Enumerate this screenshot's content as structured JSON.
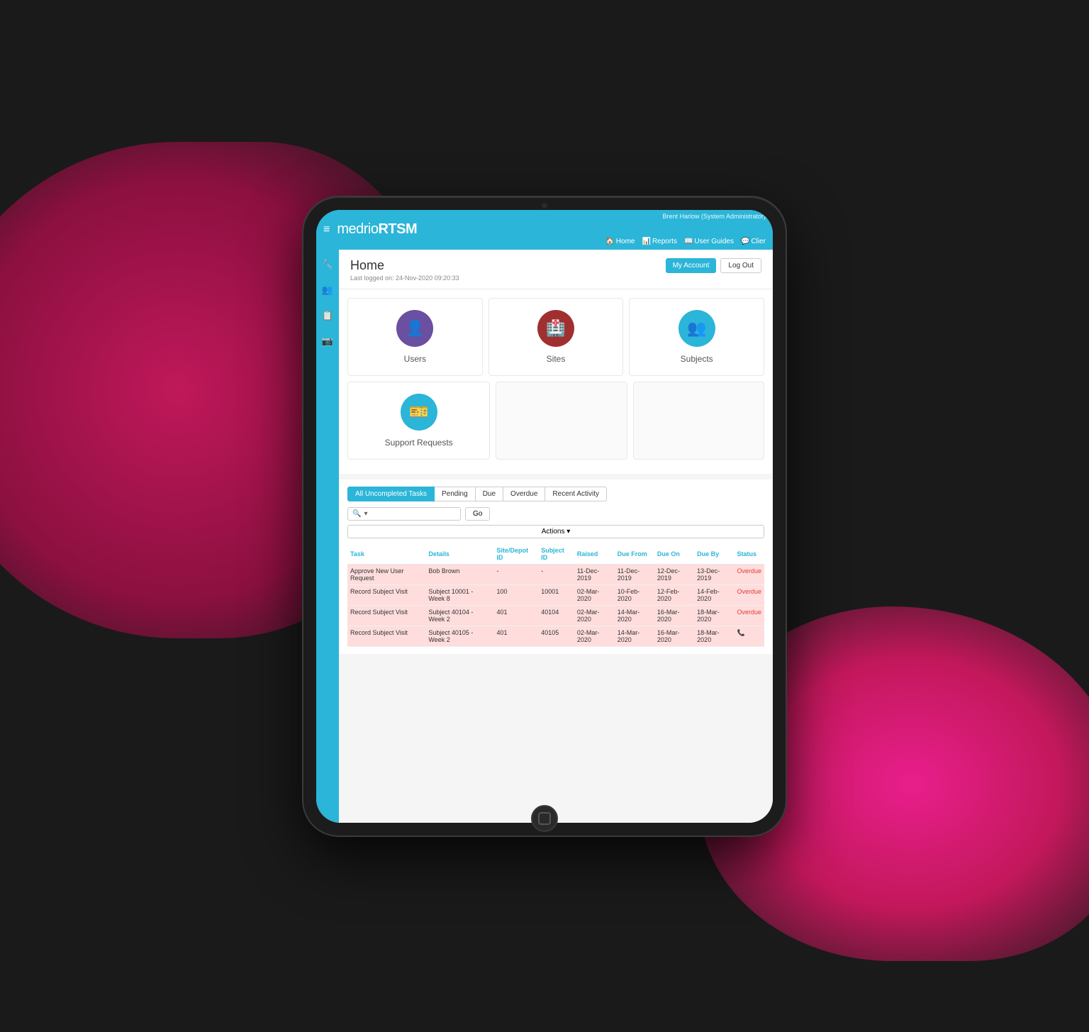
{
  "background": {
    "blob1_color": "#c0185a",
    "blob2_color": "#e91e8c"
  },
  "header": {
    "logo_text": "medrio",
    "logo_suffix": "RTSM",
    "user_info": "Brent Harlow (System Administrator)",
    "hamburger": "≡",
    "nav_items": [
      {
        "icon": "🏠",
        "label": "Home"
      },
      {
        "icon": "📊",
        "label": "Reports"
      },
      {
        "icon": "📖",
        "label": "User Guides"
      },
      {
        "icon": "💬",
        "label": "Clier"
      }
    ]
  },
  "sidebar": {
    "icons": [
      "🔧",
      "👥",
      "📋",
      "📷"
    ]
  },
  "page": {
    "title": "Home",
    "subtitle": "Last logged on: 24-Nov-2020 09:20:33",
    "my_account_label": "My Account",
    "logout_label": "Log Out"
  },
  "tiles": [
    {
      "id": "users",
      "label": "Users",
      "icon": "👤",
      "color_class": "tile-icon-users"
    },
    {
      "id": "sites",
      "label": "Sites",
      "icon": "🏥",
      "color_class": "tile-icon-sites"
    },
    {
      "id": "subjects",
      "label": "Subjects",
      "icon": "👥",
      "color_class": "tile-icon-subjects"
    },
    {
      "id": "support",
      "label": "Support Requests",
      "icon": "🎫",
      "color_class": "tile-icon-support"
    }
  ],
  "tabs": [
    {
      "id": "all",
      "label": "All Uncompleted Tasks",
      "active": true
    },
    {
      "id": "pending",
      "label": "Pending",
      "active": false
    },
    {
      "id": "due",
      "label": "Due",
      "active": false
    },
    {
      "id": "overdue",
      "label": "Overdue",
      "active": false
    },
    {
      "id": "recent",
      "label": "Recent Activity",
      "active": false
    }
  ],
  "search": {
    "placeholder": "🔍 ▾",
    "go_label": "Go"
  },
  "actions": {
    "label": "Actions ▾"
  },
  "table": {
    "columns": [
      "Task",
      "Details",
      "Site/Depot ID",
      "Subject ID",
      "Raised",
      "Due From",
      "Due On",
      "Due By",
      "Status"
    ],
    "rows": [
      {
        "task": "Approve New User Request",
        "details": "Bob Brown",
        "site_id": "-",
        "subject_id": "-",
        "raised": "11-Dec-2019",
        "due_from": "11-Dec-2019",
        "due_on": "12-Dec-2019",
        "due_by": "13-Dec-2019",
        "status": "Overdue",
        "status_type": "text",
        "overdue": true
      },
      {
        "task": "Record Subject Visit",
        "details": "Subject 10001 - Week 8",
        "site_id": "100",
        "subject_id": "10001",
        "raised": "02-Mar-2020",
        "due_from": "10-Feb-2020",
        "due_on": "12-Feb-2020",
        "due_by": "14-Feb-2020",
        "status": "Overdue",
        "status_type": "text",
        "overdue": true
      },
      {
        "task": "Record Subject Visit",
        "details": "Subject 40104 - Week 2",
        "site_id": "401",
        "subject_id": "40104",
        "raised": "02-Mar-2020",
        "due_from": "14-Mar-2020",
        "due_on": "16-Mar-2020",
        "due_by": "18-Mar-2020",
        "status": "Overdue",
        "status_type": "text",
        "overdue": true
      },
      {
        "task": "Record Subject Visit",
        "details": "Subject 40105 - Week 2",
        "site_id": "401",
        "subject_id": "40105",
        "raised": "02-Mar-2020",
        "due_from": "14-Mar-2020",
        "due_on": "16-Mar-2020",
        "due_by": "18-Mar-2020",
        "status": "📞",
        "status_type": "icon",
        "overdue": true
      }
    ]
  }
}
